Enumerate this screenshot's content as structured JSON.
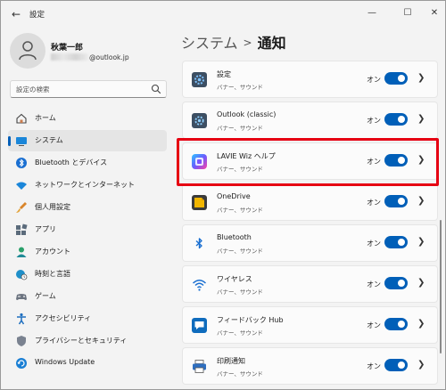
{
  "window": {
    "title": "設定",
    "back_icon": "arrow-left-icon",
    "controls": [
      "minimize-icon",
      "maximize-icon",
      "close-icon"
    ]
  },
  "user": {
    "name": "秋葉一郎",
    "email_visible": "@outlook.jp"
  },
  "search": {
    "placeholder": "設定の検索"
  },
  "sidebar": {
    "items": [
      {
        "label": "ホーム",
        "icon": "home-icon",
        "selected": false
      },
      {
        "label": "システム",
        "icon": "system-display-icon",
        "selected": true
      },
      {
        "label": "Bluetooth とデバイス",
        "icon": "bluetooth-icon",
        "selected": false
      },
      {
        "label": "ネットワークとインターネット",
        "icon": "wifi-icon",
        "selected": false
      },
      {
        "label": "個人用設定",
        "icon": "brush-icon",
        "selected": false
      },
      {
        "label": "アプリ",
        "icon": "apps-icon",
        "selected": false
      },
      {
        "label": "アカウント",
        "icon": "account-icon",
        "selected": false
      },
      {
        "label": "時刻と言語",
        "icon": "globe-clock-icon",
        "selected": false
      },
      {
        "label": "ゲーム",
        "icon": "gamepad-icon",
        "selected": false
      },
      {
        "label": "アクセシビリティ",
        "icon": "accessibility-icon",
        "selected": false
      },
      {
        "label": "プライバシーとセキュリティ",
        "icon": "shield-icon",
        "selected": false
      },
      {
        "label": "Windows Update",
        "icon": "windows-update-icon",
        "selected": false
      }
    ]
  },
  "breadcrumb": {
    "parent": "システム",
    "separator": ">",
    "current": "通知"
  },
  "apps": [
    {
      "name": "設定",
      "sub": "バナー、サウンド",
      "state": "オン",
      "on": true,
      "icon": "gear-icon"
    },
    {
      "name": "Outlook (classic)",
      "sub": "バナー、サウンド",
      "state": "オン",
      "on": true,
      "icon": "outlook-icon"
    },
    {
      "name": "LAVIE Wiz ヘルプ",
      "sub": "バナー、サウンド",
      "state": "オン",
      "on": true,
      "icon": "lavie-wiz-icon",
      "highlighted": true
    },
    {
      "name": "OneDrive",
      "sub": "バナー、サウンド",
      "state": "オン",
      "on": true,
      "icon": "onedrive-icon"
    },
    {
      "name": "Bluetooth",
      "sub": "バナー、サウンド",
      "state": "オン",
      "on": true,
      "icon": "bluetooth-icon"
    },
    {
      "name": "ワイヤレス",
      "sub": "バナー、サウンド",
      "state": "オン",
      "on": true,
      "icon": "wireless-icon"
    },
    {
      "name": "フィードバック Hub",
      "sub": "バナー、サウンド",
      "state": "オン",
      "on": true,
      "icon": "feedback-hub-icon"
    },
    {
      "name": "印刷通知",
      "sub": "バナー、サウンド",
      "state": "オン",
      "on": true,
      "icon": "printer-icon"
    }
  ],
  "colors": {
    "accent": "#005fb8",
    "highlight_box": "#e60012",
    "window_bg": "#f3f3f3",
    "card_bg": "#fbfbfb"
  }
}
